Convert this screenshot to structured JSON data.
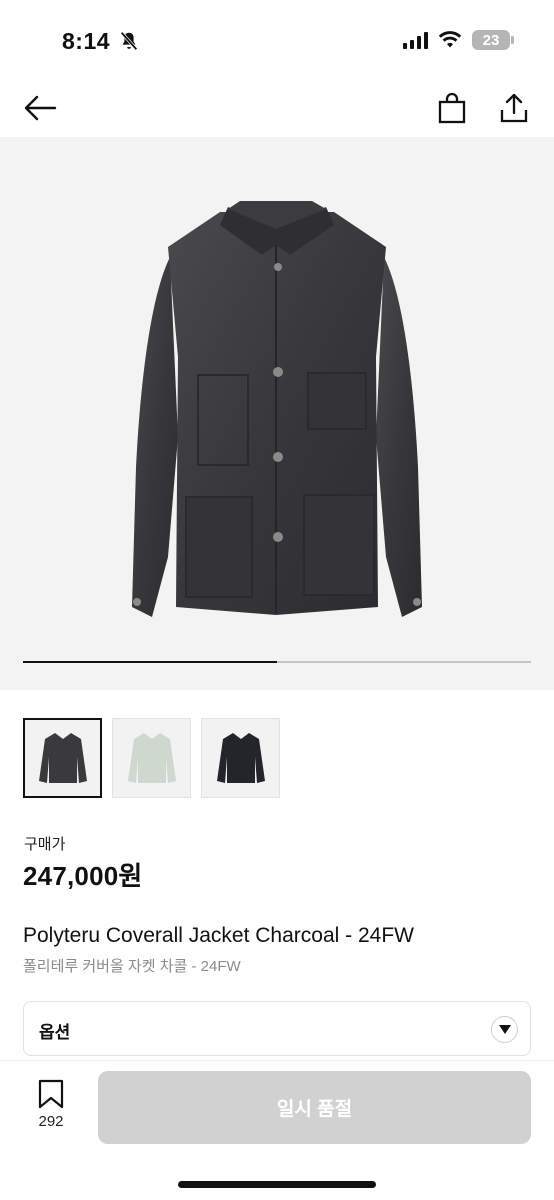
{
  "status": {
    "time": "8:14",
    "battery": "23"
  },
  "icons": {
    "back": "arrow-left-icon",
    "bag": "shopping-bag-icon",
    "share": "share-icon",
    "bookmark": "bookmark-icon",
    "option_toggle": "triangle-down-icon",
    "silent": "bell-slash-icon"
  },
  "gallery": {
    "progress": 0.5,
    "thumbnails": [
      {
        "color": "#3a3a3c",
        "selected": true
      },
      {
        "color": "#cfd8cf",
        "selected": false
      },
      {
        "color": "#23252b",
        "selected": false
      }
    ]
  },
  "product": {
    "price_label": "구매가",
    "price": "247,000원",
    "name_en": "Polyteru Coverall Jacket Charcoal - 24FW",
    "name_ko": "폴리테루 커버올 자켓 차콜 - 24FW"
  },
  "option": {
    "label": "옵션"
  },
  "bottom": {
    "bookmark_count": "292",
    "buy_label": "일시 품절"
  },
  "colors": {
    "soldout_bg": "#d1d1d1",
    "hero_bg": "#f3f3f3",
    "jacket": "#3a3a3c"
  }
}
